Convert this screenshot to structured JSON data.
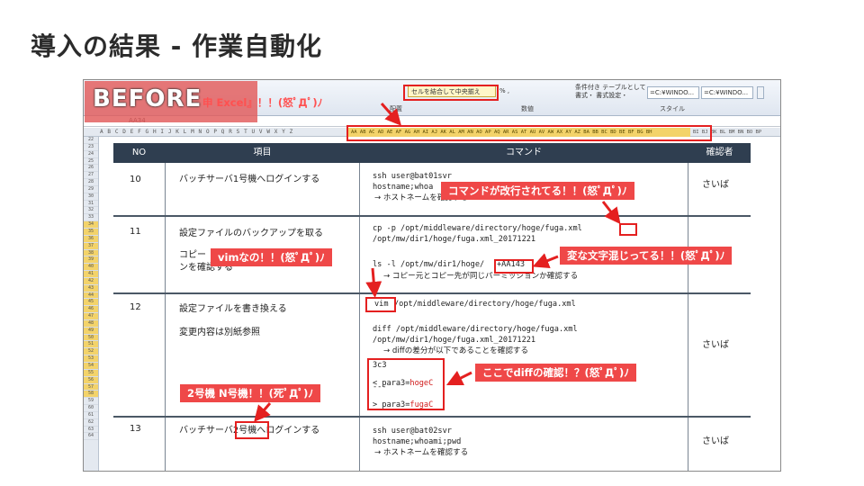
{
  "slide": {
    "title": "導入の結果 - 作業自動化"
  },
  "overlay": {
    "label": "BEFORE"
  },
  "ribbon": {
    "merge_label": "セルを結合して中央揃え",
    "percent": "% ,",
    "group_haichi": "配置",
    "group_suuchi": "数値",
    "group_style": "スタイル",
    "style_buttons": "条件付き テーブルとして\n書式・ 書式設定・",
    "style_cell_1": "=C:¥WINDO...",
    "style_cell_2": "=C:¥WINDO..."
  },
  "formula_bar": {
    "name_box": "AA34"
  },
  "columns": {
    "left": "A B C D E F G H I J K L M N O P Q R S T U V W X Y Z",
    "highlighted": "AA AB AC AD AE AF AG AH AI AJ AK AL AM AN AO AP AQ AR AS AT AU AV AW AX AY AZ BA BB BC BD BE BF BG BH",
    "right": "BI BJ BK BL BM BN BO BP"
  },
  "rows": [
    "22",
    "23",
    "24",
    "25",
    "26",
    "27",
    "28",
    "29",
    "30",
    "31",
    "32",
    "33",
    "34",
    "35",
    "36",
    "37",
    "38",
    "39",
    "40",
    "41",
    "42",
    "43",
    "44",
    "45",
    "46",
    "47",
    "48",
    "49",
    "50",
    "51",
    "52",
    "53",
    "54",
    "55",
    "56",
    "57",
    "58",
    "59",
    "60",
    "61",
    "62",
    "63",
    "64"
  ],
  "table": {
    "headers": {
      "no": "NO",
      "item": "項目",
      "command": "コマンド",
      "checker": "確認者"
    },
    "rows": [
      {
        "no": "10",
        "item": [
          "バッチサーバ1号機へログインする"
        ],
        "cmd": [
          "ssh user@bat01svr",
          "hostname;whoa",
          "→ ホストネームを確認する"
        ],
        "checker": "さいば"
      },
      {
        "no": "11",
        "item": [
          "設定ファイルのバックアップを取る",
          "コピー",
          "ンを確認する"
        ],
        "cmd": [
          "cp -p /opt/middleware/directory/hoge/fuga.xml",
          "/opt/mw/dir1/hoge/fuga.xml_20171221",
          "ls -l /opt/mw/dir1/hoge/",
          "+AA143",
          "→ コピー元とコピー先が同じパーミッションか確認する"
        ],
        "checker": ""
      },
      {
        "no": "12",
        "item": [
          "設定ファイルを書き換える",
          "変更内容は別紙参照"
        ],
        "cmd": [
          "vim",
          "/opt/middleware/directory/hoge/fuga.xml",
          "diff /opt/middleware/directory/hoge/fuga.xml",
          "/opt/mw/dir1/hoge/fuga.xml_20171221",
          "→ diffの差分が以下であることを確認する",
          "3c3",
          "< para3=",
          "hogeC",
          "---",
          "> para3=",
          "fugaC"
        ],
        "checker": "さいば"
      },
      {
        "no": "13",
        "item": [
          "バッチサーバ",
          "2号機",
          "へログインする"
        ],
        "cmd": [
          "ssh user@bat02svr",
          "hostname;whoami;pwd",
          "→ ホストネームを確認する"
        ],
        "checker": "さいば"
      }
    ]
  },
  "callouts": {
    "tab": "申 Excel』！！(怒ﾟДﾟ)ﾉ",
    "newline": "コマンドが改行されてる！！(怒ﾟДﾟ)ﾉ",
    "strange_char": "変な文字混じってる！！(怒ﾟДﾟ)ﾉ",
    "vim": "vimなの！！(怒ﾟДﾟ)ﾉ",
    "diff": "ここでdiffの確認！？(怒ﾟДﾟ)ﾉ",
    "server2": "2号機 N号機！！(死ﾟДﾟ)ﾉ"
  },
  "colors": {
    "accent": "#ef4848",
    "header_bg": "#2f3e50",
    "highlight_col": "#f3d36a"
  }
}
